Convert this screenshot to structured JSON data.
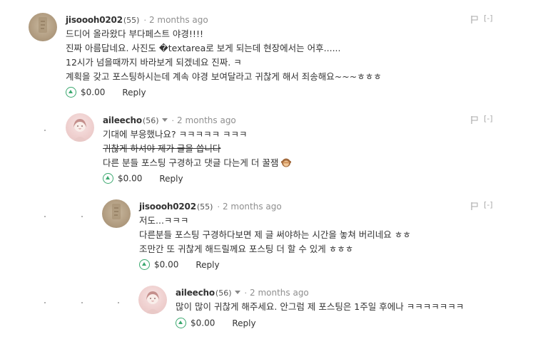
{
  "comments": [
    {
      "author": "jisoooh0202",
      "reputation": "(55)",
      "time": "2 months ago",
      "lines": [
        "드디어 올라왔다 부다페스트 야경!!!!",
        "진짜 아름답네요. 사진도 �textarea로 보게 되는데 현장에서는 어후......",
        "12시가 넘을때까지 바라보게 되겠네요 진짜. ㅋ",
        "계획을 갖고 포스팅하시는데 계속 야경 보여달라고 귀찮게 해서 죄송해요~~~ㅎㅎㅎ"
      ],
      "payout": "$0.00",
      "reply": "Reply",
      "collapse": "[-]"
    },
    {
      "author": "aileecho",
      "reputation": "(56)",
      "time": "2 months ago",
      "lines": [
        "기대에 부응했나요? ㅋㅋㅋㅋㅋ ㅋㅋㅋ",
        "귀찮게 하셔야 제가 글을 씁니다",
        "다른 분들 포스팅 구경하고 댓글 다는게 더 꿀잼"
      ],
      "payout": "$0.00",
      "reply": "Reply",
      "collapse": "[-]"
    },
    {
      "author": "jisoooh0202",
      "reputation": "(55)",
      "time": "2 months ago",
      "lines": [
        "저도...ㅋㅋㅋ",
        "다른분들 포스팅 구경하다보면 제 글 써야하는 시간을 놓쳐 버리네요 ㅎㅎ",
        "조만간 또 귀찮게 해드릴께요 포스팅 더 할 수 있게 ㅎㅎㅎ"
      ],
      "payout": "$0.00",
      "reply": "Reply",
      "collapse": "[-]"
    },
    {
      "author": "aileecho",
      "reputation": "(56)",
      "time": "2 months ago",
      "lines": [
        "많이 많이 귀찮게 해주세요. 안그럼 제 포스팅은 1주일 후에나 ㅋㅋㅋㅋㅋㅋㅋ"
      ],
      "payout": "$0.00",
      "reply": "Reply",
      "collapse": "[-]"
    }
  ],
  "icons": {
    "upvote": "upvote-chevron-icon",
    "flag": "flag-icon",
    "emoji": "see-no-evil-monkey-emoji"
  },
  "colors": {
    "upvote_green": "#3ba86f",
    "meta_gray": "#8f8f8f"
  }
}
